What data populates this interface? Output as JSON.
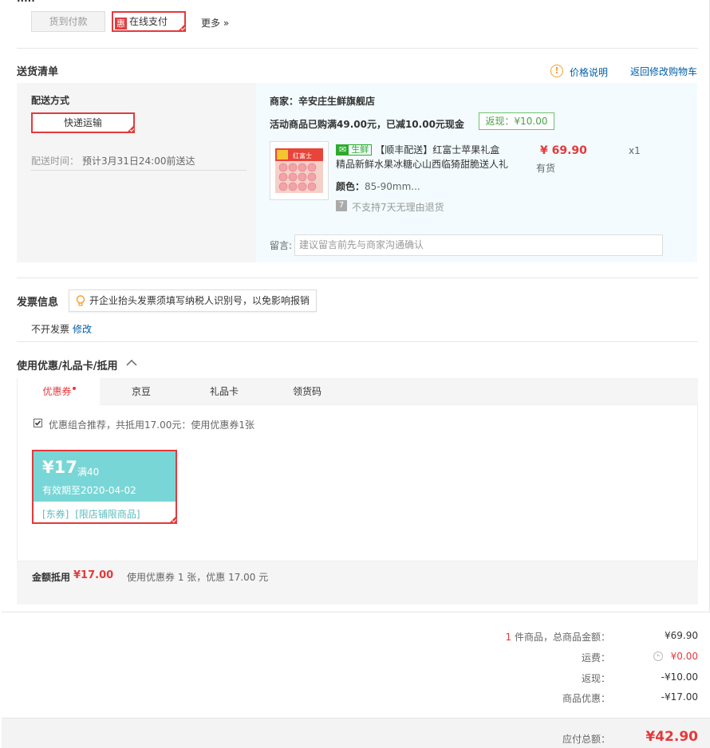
{
  "payment": {
    "cod_label": "货到付款",
    "online_icon": "惠",
    "online_label": "在线支付",
    "more_label": "更多 »"
  },
  "delivery": {
    "title": "送货清单",
    "price_note_label": "价格说明",
    "back_to_cart_label": "返回修改购物车",
    "method_title": "配送方式",
    "method_button": "快递运输",
    "time_label": "配送时间：",
    "time_value": "预计3月31日24:00前送达"
  },
  "order": {
    "merchant_label": "商家：辛安庄生鲜旗舰店",
    "promo_text": "活动商品已购满49.00元，已减10.00元现金",
    "rebate_badge": "返现：¥10.00",
    "product": {
      "fresh_tag_icon": "✉",
      "fresh_tag_text": "生鲜",
      "title_line1": "【顺丰配送】红富士苹果礼盒",
      "title_line2": "精品新鲜水果冰糖心山西临猗甜脆送人礼",
      "color_label": "颜色：",
      "color_value": "85-90mm...",
      "return_icon": "7",
      "return_text": "不支持7天无理由退货",
      "price": "¥ 69.90",
      "stock": "有货",
      "qty": "x1",
      "image_text": "红富士"
    },
    "memo_label": "留言:",
    "memo_placeholder": "建议留言前先与商家沟通确认"
  },
  "invoice": {
    "title": "发票信息",
    "tip": "开企业抬头发票须填写纳税人识别号，以免影响报销",
    "status": "不开发票",
    "edit_label": "修改"
  },
  "discount": {
    "title": "使用优惠/礼品卡/抵用",
    "tabs": [
      "优惠券",
      "京豆",
      "礼品卡",
      "领货码"
    ],
    "recommend_text": "优惠组合推荐，共抵用17.00元：使用优惠券1张",
    "coupon": {
      "amount": "¥17",
      "condition": "满40",
      "expiry": "有效期至2020-04-02",
      "tag1": "[东券]",
      "tag2": "[限店铺限商品]"
    },
    "summary_label": "金额抵用",
    "summary_amount": "¥17.00",
    "summary_detail": "使用优惠券 1 张，优惠 17.00 元"
  },
  "totals": {
    "count": "1",
    "count_suffix": "件商品，总商品金额：",
    "goods_total": "¥69.90",
    "shipping_label": "运费：",
    "shipping_value": "¥0.00",
    "rebate_label": "返现：",
    "rebate_value": "-¥10.00",
    "coupon_label": "商品优惠：",
    "coupon_value": "-¥17.00",
    "payable_label": "应付总额：",
    "payable_value": "¥42.90"
  },
  "colors": {
    "accent_red": "#e4393c",
    "link_blue": "#005ea7",
    "coupon_teal": "#79d6d6",
    "fresh_green": "#2dab2d"
  }
}
